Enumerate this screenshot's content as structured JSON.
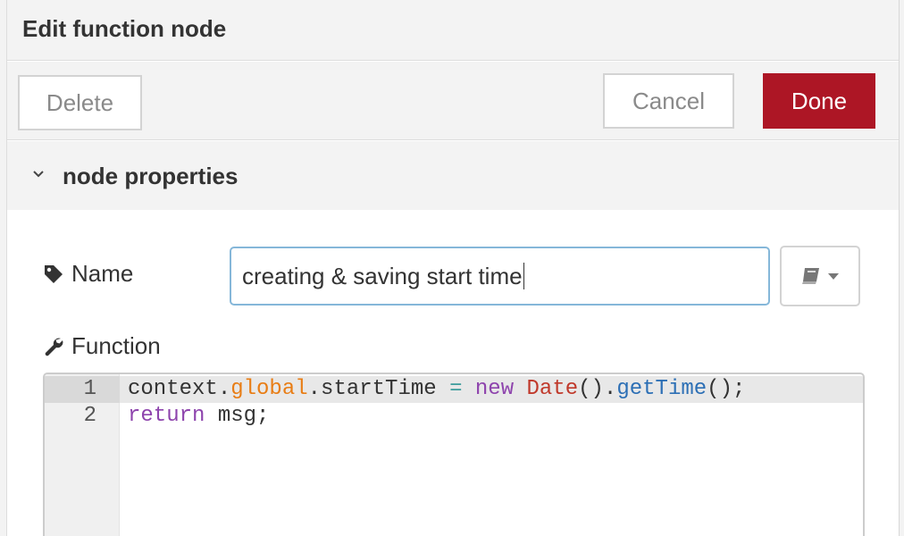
{
  "dialog": {
    "title": "Edit function node"
  },
  "toolbar": {
    "delete_label": "Delete",
    "cancel_label": "Cancel",
    "done_label": "Done"
  },
  "section": {
    "label": "node properties",
    "icon": "chevron-down-icon"
  },
  "fields": {
    "name_label": "Name",
    "name_icon": "tag-icon",
    "name_value": "creating & saving start time",
    "library_icon": "book-icon",
    "function_label": "Function",
    "function_icon": "wrench-icon"
  },
  "editor": {
    "lines": [
      {
        "number": "1",
        "tokens": [
          {
            "text": "context.",
            "type": "plain"
          },
          {
            "text": "global",
            "type": "prop"
          },
          {
            "text": ".startTime ",
            "type": "plain"
          },
          {
            "text": "=",
            "type": "op"
          },
          {
            "text": " ",
            "type": "plain"
          },
          {
            "text": "new",
            "type": "kw"
          },
          {
            "text": " ",
            "type": "plain"
          },
          {
            "text": "Date",
            "type": "type"
          },
          {
            "text": "().",
            "type": "plain"
          },
          {
            "text": "getTime",
            "type": "fn"
          },
          {
            "text": "();",
            "type": "plain"
          }
        ]
      },
      {
        "number": "2",
        "tokens": [
          {
            "text": "return",
            "type": "kw"
          },
          {
            "text": " msg;",
            "type": "plain"
          }
        ]
      }
    ]
  },
  "colors": {
    "done_button": "#ad1625",
    "input_focus_border": "#85b7d9",
    "panel_background": "#f3f3f3"
  }
}
